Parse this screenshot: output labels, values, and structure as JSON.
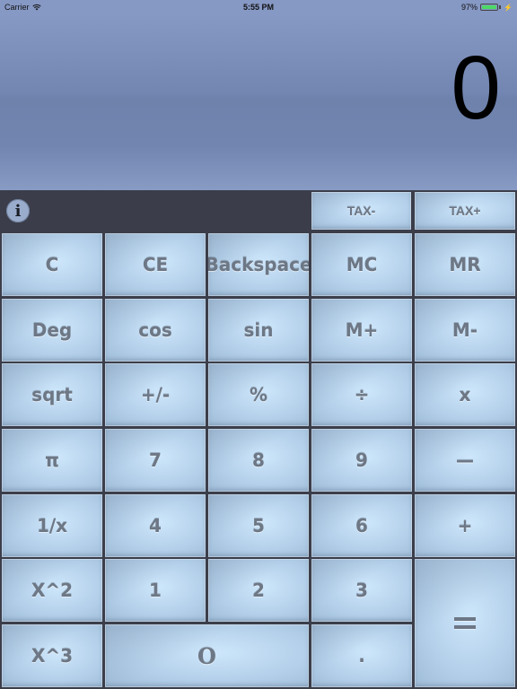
{
  "status_bar": {
    "carrier": "Carrier",
    "time": "5:55 PM",
    "battery_percent": "97%",
    "battery_level": 0.97
  },
  "display": {
    "value": "0"
  },
  "toolbar": {
    "info_icon": "i",
    "tax_minus": "TAX-",
    "tax_plus": "TAX+"
  },
  "keys": {
    "clear": "C",
    "clear_entry": "CE",
    "backspace": "Backspace",
    "memory_clear": "MC",
    "memory_recall": "MR",
    "deg": "Deg",
    "cos": "cos",
    "sin": "sin",
    "memory_add": "M+",
    "memory_subtract": "M-",
    "sqrt": "sqrt",
    "negate": "+/-",
    "percent": "%",
    "divide": "÷",
    "multiply": "x",
    "pi": "π",
    "seven": "7",
    "eight": "8",
    "nine": "9",
    "subtract": "—",
    "reciprocal": "1/x",
    "four": "4",
    "five": "5",
    "six": "6",
    "add": "+",
    "square": "X^2",
    "one": "1",
    "two": "2",
    "three": "3",
    "cube": "X^3",
    "zero": "O",
    "decimal": "."
  }
}
